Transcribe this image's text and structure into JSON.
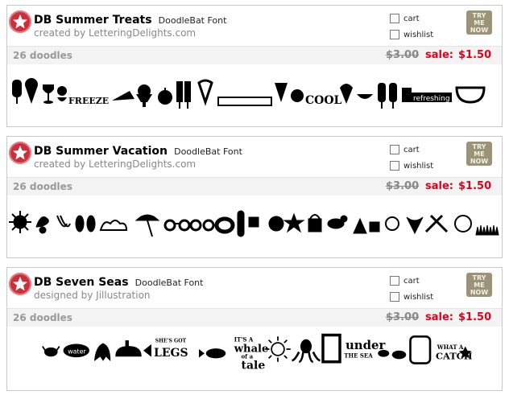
{
  "products": [
    {
      "name": "DB Summer Treats",
      "type": "DoodleBat Font",
      "credit": "created by LetteringDelights.com",
      "cart_label": "cart",
      "wishlist_label": "wishlist",
      "try_label": "TRY ME NOW",
      "doodle_count": "26 doodles",
      "old_price": "$3.00",
      "sale_label": "sale:",
      "sale_price": "$1.50",
      "sample_words": [
        "FREEZE",
        "COOL",
        "refreshing"
      ]
    },
    {
      "name": "DB Summer Vacation",
      "type": "DoodleBat Font",
      "credit": "created by LetteringDelights.com",
      "cart_label": "cart",
      "wishlist_label": "wishlist",
      "try_label": "TRY ME NOW",
      "doodle_count": "26 doodles",
      "old_price": "$3.00",
      "sale_label": "sale:",
      "sale_price": "$1.50",
      "sample_words": []
    },
    {
      "name": "DB Seven Seas",
      "type": "DoodleBat Font",
      "credit": "designed by Jillustration",
      "cart_label": "cart",
      "wishlist_label": "wishlist",
      "try_label": "TRY ME NOW",
      "doodle_count": "26 doodles",
      "old_price": "$3.00",
      "sale_label": "sale:",
      "sale_price": "$1.50",
      "sample_words": [
        "water",
        "SHE'S GOT",
        "LEGS",
        "whale",
        "of a",
        "tale",
        "under",
        "THE SEA",
        "CATCH"
      ]
    }
  ],
  "colors": {
    "sale_red": "#e2001a",
    "badge_red": "#c8313b",
    "muted_gray": "#888888",
    "try_button": "#9a9378"
  },
  "icons": [
    "star-icon",
    "checkbox-icon"
  ]
}
